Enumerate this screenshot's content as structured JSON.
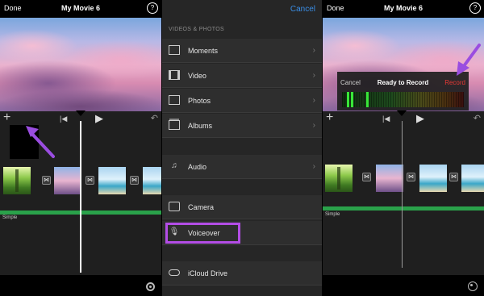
{
  "left_panel": {
    "done": "Done",
    "title": "My Movie 6",
    "help": "?",
    "track_label": "Simple"
  },
  "picker": {
    "cancel": "Cancel",
    "section_title": "VIDEOS & PHOTOS",
    "items": [
      {
        "label": "Moments",
        "icon": "moments-icon"
      },
      {
        "label": "Video",
        "icon": "film-icon"
      },
      {
        "label": "Photos",
        "icon": "photo-icon"
      },
      {
        "label": "Albums",
        "icon": "album-icon"
      },
      {
        "label": "Audio",
        "icon": "music-note-icon"
      },
      {
        "label": "Camera",
        "icon": "camera-icon"
      },
      {
        "label": "Voiceover",
        "icon": "microphone-icon"
      },
      {
        "label": "iCloud Drive",
        "icon": "cloud-icon"
      }
    ]
  },
  "right_panel": {
    "done": "Done",
    "title": "My Movie 6",
    "help": "?",
    "track_label": "Simple",
    "record_dialog": {
      "cancel": "Cancel",
      "title": "Ready to Record",
      "record": "Record"
    }
  },
  "colors": {
    "accent_blue": "#3a8ee6",
    "record_red": "#e53935",
    "highlight_purple": "#b34de6",
    "audio_track_green": "#2aa14a"
  }
}
